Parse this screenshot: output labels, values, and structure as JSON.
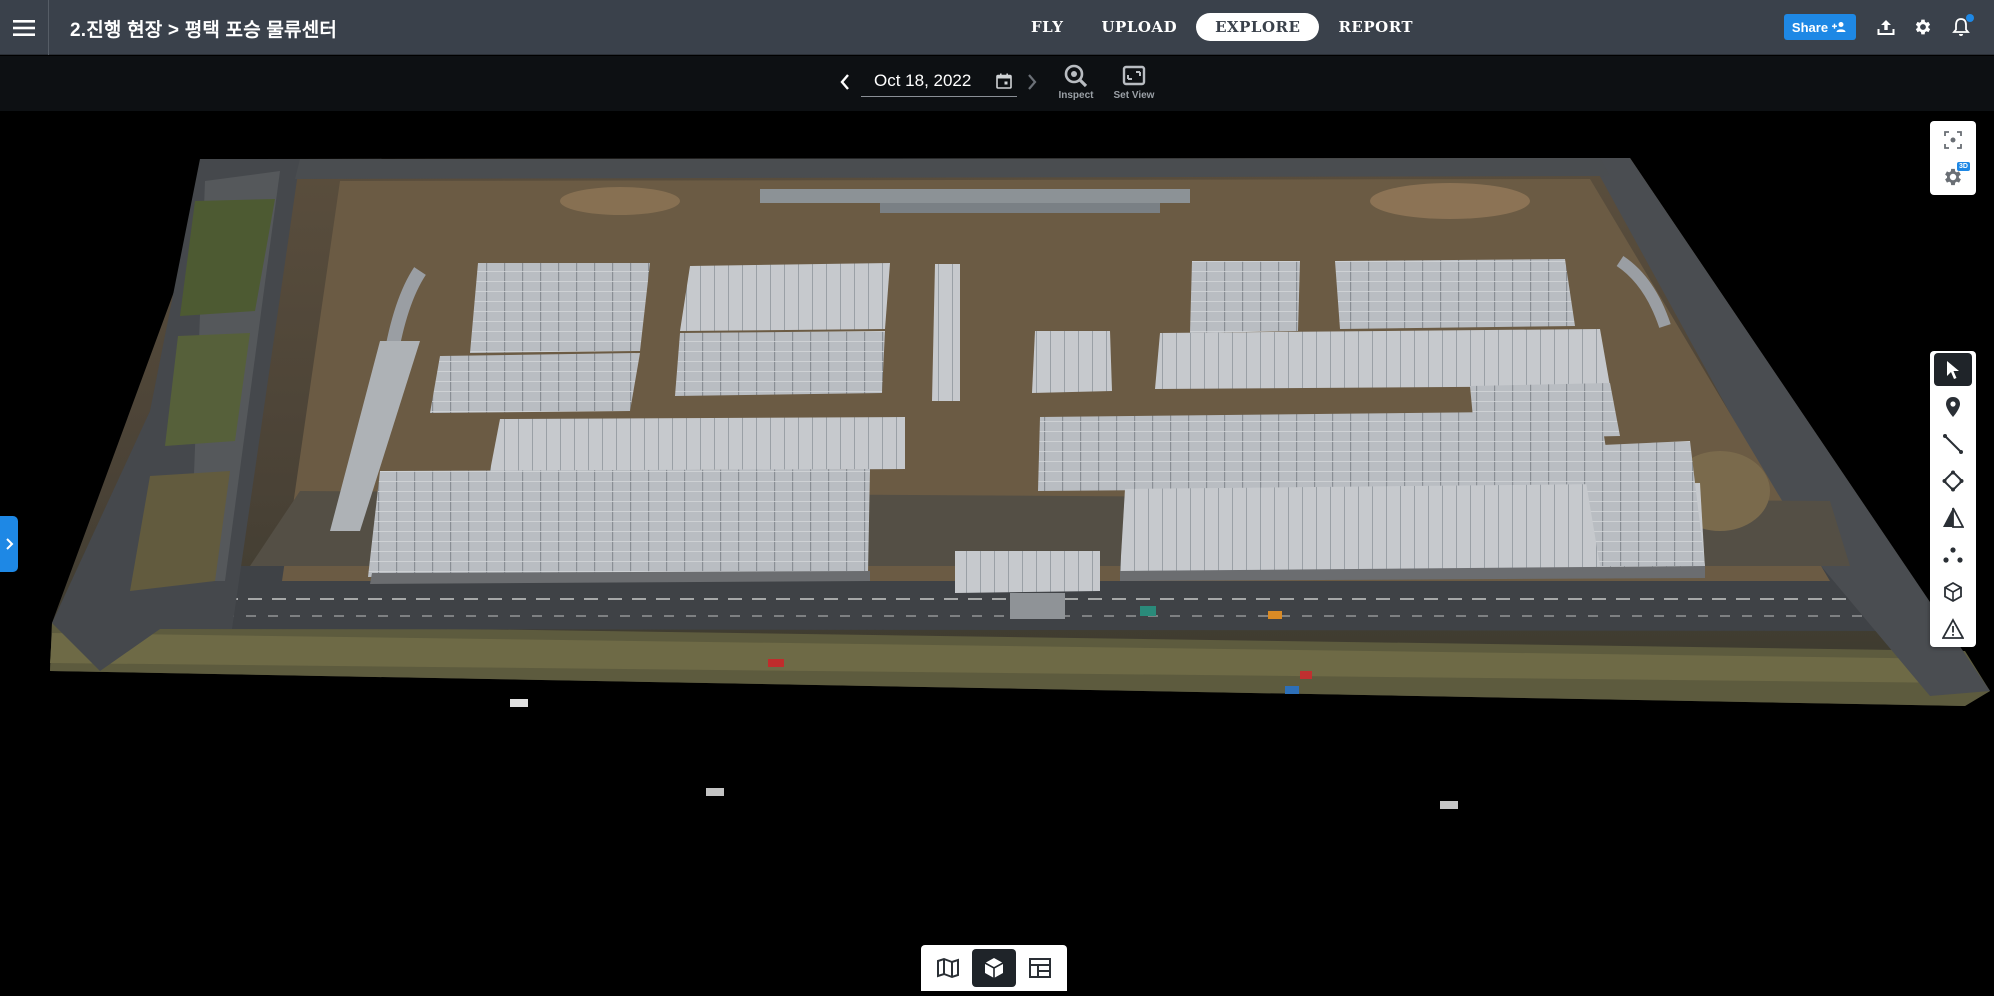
{
  "header": {
    "breadcrumb": "2.진행 현장 > 평택 포승 물류센터",
    "nav": [
      "FLY",
      "UPLOAD",
      "EXPLORE",
      "REPORT"
    ],
    "active_nav": "EXPLORE",
    "share_label": "Share"
  },
  "toolbar": {
    "date": "Oct 18, 2022",
    "inspect_label": "Inspect",
    "set_view_label": "Set View"
  },
  "side_tools": {
    "top": [
      "focus-frame-icon",
      "settings-3d-icon"
    ],
    "badge": "3D",
    "annotate": [
      "select-cursor-icon",
      "location-pin-icon",
      "line-measure-icon",
      "polygon-area-icon",
      "elevation-profile-icon",
      "points-icon",
      "volume-cube-icon",
      "warning-icon"
    ]
  },
  "view_modes": [
    "map-icon",
    "3d-model-icon",
    "layout-compare-icon"
  ],
  "colors": {
    "topbar": "#3a414b",
    "accent": "#1e88e5",
    "toolbar": "#0d1013"
  }
}
